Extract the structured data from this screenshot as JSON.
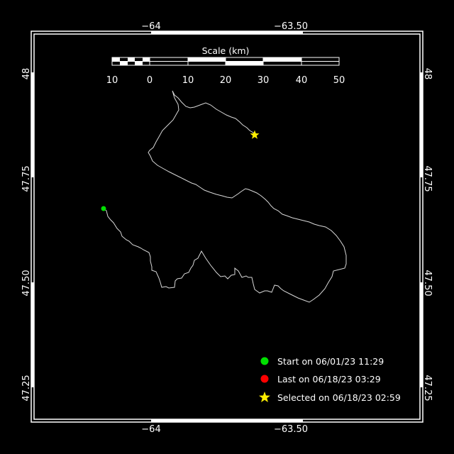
{
  "map": {
    "axes": {
      "top_ticks": [
        "−64",
        "−63.50"
      ],
      "bottom_ticks": [
        "−64",
        "−63.50"
      ],
      "left_ticks": [
        "48",
        "47.75",
        "47.50",
        "47.25"
      ],
      "right_ticks": [
        "48",
        "47.75",
        "47.50",
        "47.25"
      ]
    },
    "scale_bar": {
      "title": "Scale (km)",
      "labels": [
        "10",
        "0",
        "10",
        "20",
        "30",
        "40",
        "50"
      ]
    },
    "legend": {
      "start": "Start on 06/01/23 11:29",
      "last": "Last on 06/18/23 03:29",
      "selected": "Selected on 06/18/23 02:59"
    },
    "colors": {
      "background": "#000000",
      "frame": "#ffffff",
      "track": "#d8d8d8",
      "start": "#00e000",
      "last": "#ff0000",
      "selected": "#ffee00"
    }
  }
}
